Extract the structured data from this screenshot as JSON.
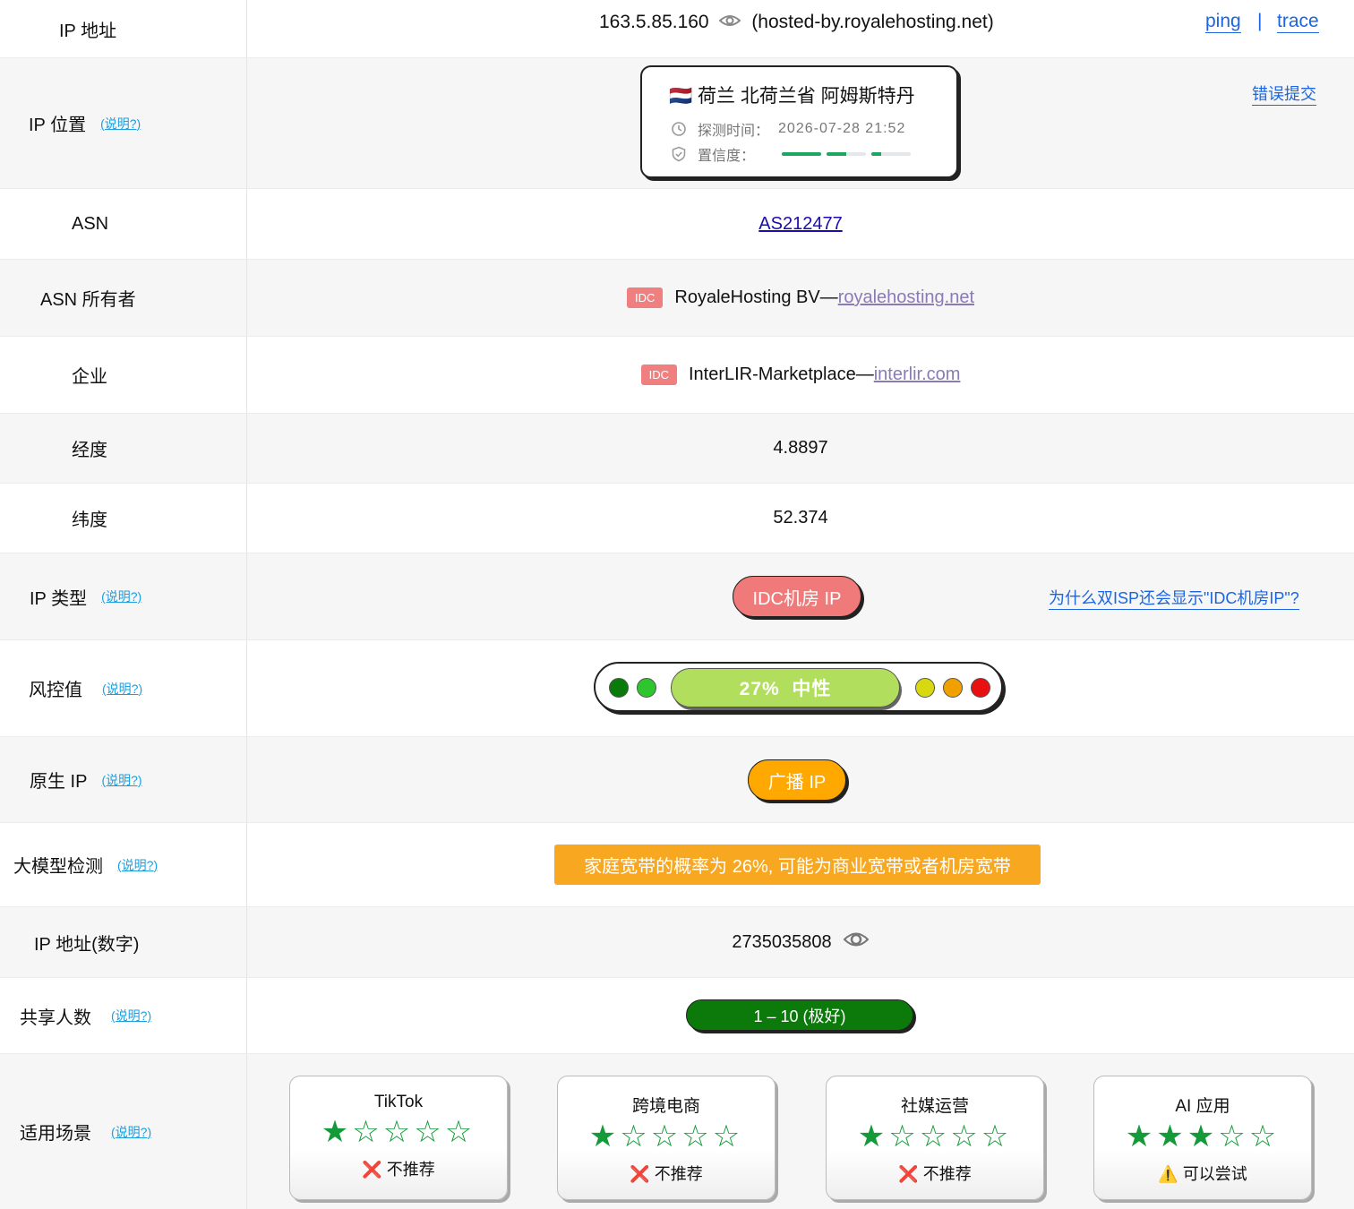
{
  "ip_row": {
    "label": "IP 地址",
    "ip": "163.5.85.160",
    "host": "(hosted-by.royalehosting.net)",
    "ping": "ping",
    "sep": "|",
    "trace": "trace"
  },
  "location_row": {
    "label": "IP 位置",
    "help": "(说明?)",
    "flag": "🇳🇱",
    "place": "荷兰 北荷兰省 阿姆斯特丹",
    "time_label": "探测时间：",
    "time_value": "2026-07-28 21:52",
    "conf_label": "置信度：",
    "report": "错误提交"
  },
  "asn_row": {
    "label": "ASN",
    "value": "AS212477"
  },
  "asn_owner_row": {
    "label": "ASN 所有者",
    "tag": "IDC",
    "name": "RoyaleHosting BV—",
    "link": "royalehosting.net"
  },
  "company_row": {
    "label": "企业",
    "tag": "IDC",
    "name": "InterLIR-Marketplace—",
    "link": "interlir.com"
  },
  "lon_row": {
    "label": "经度",
    "value": "4.8897"
  },
  "lat_row": {
    "label": "纬度",
    "value": "52.374"
  },
  "type_row": {
    "label": "IP 类型",
    "help": "(说明?)",
    "value": "IDC机房 IP",
    "why": "为什么双ISP还会显示\"IDC机房IP\"?"
  },
  "risk_row": {
    "label": "风控值",
    "help": "(说明?)",
    "value": "27%  中性",
    "colors": [
      "#0a7a0a",
      "#2ec52e",
      "#d8d810",
      "#f0a000",
      "#e81010"
    ]
  },
  "native_row": {
    "label": "原生 IP",
    "help": "(说明?)",
    "value": "广播 IP"
  },
  "llm_row": {
    "label": "大模型检测",
    "help": "(说明?)",
    "value": "家庭宽带的概率为 26%, 可能为商业宽带或者机房宽带"
  },
  "ipnum_row": {
    "label": "IP 地址(数字)",
    "value": "2735035808"
  },
  "share_row": {
    "label": "共享人数",
    "help": "(说明?)",
    "value": "1 – 10 (极好)"
  },
  "scene_row": {
    "label": "适用场景",
    "help": "(说明?)",
    "cards": [
      {
        "name": "TikTok",
        "stars": "★☆☆☆☆",
        "icon": "❌",
        "verdict": "不推荐"
      },
      {
        "name": "跨境电商",
        "stars": "★☆☆☆☆",
        "icon": "❌",
        "verdict": "不推荐"
      },
      {
        "name": "社媒运营",
        "stars": "★☆☆☆☆",
        "icon": "❌",
        "verdict": "不推荐"
      },
      {
        "name": "AI 应用",
        "stars": "★★★☆☆",
        "icon": "⚠️",
        "verdict": "可以尝试"
      }
    ]
  }
}
